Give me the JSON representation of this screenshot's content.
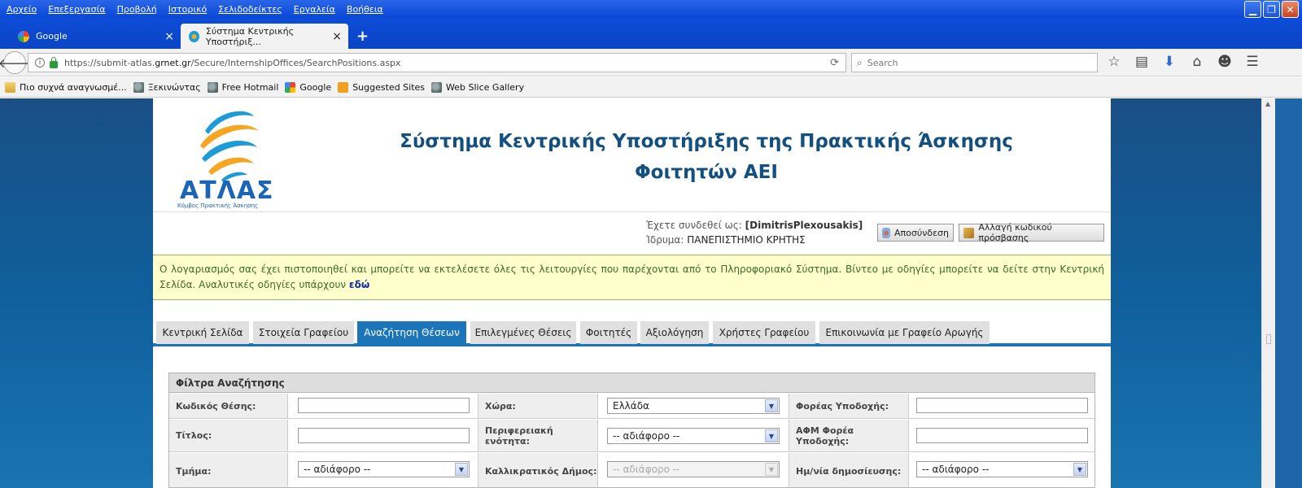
{
  "browser": {
    "menu": [
      "Αρχείο",
      "Επεξεργασία",
      "Προβολή",
      "Ιστορικό",
      "Σελιδοδείκτες",
      "Εργαλεία",
      "Βοήθεια"
    ],
    "tabs": [
      {
        "title": "Google",
        "close": "×"
      },
      {
        "title": "Σύστημα Κεντρικής Υποστήριξ...",
        "close": "×"
      }
    ],
    "new_tab": "+",
    "url_prefix": "https://submit-atlas.",
    "url_domain": "grnet.gr",
    "url_path": "/Secure/InternshipOffices/SearchPositions.aspx",
    "search_placeholder": "Search",
    "bookmarks": [
      "Πιο συχνά αναγνωσμέ...",
      "Ξεκινώντας",
      "Free Hotmail",
      "Google",
      "Suggested Sites",
      "Web Slice Gallery"
    ]
  },
  "header": {
    "logo_word": "ΑΤΛΑΣ",
    "logo_sub": "Κόμβος Πρακτικής Άσκησης",
    "title_line1": "Σύστημα Κεντρικής Υποστήριξης της Πρακτικής Άσκησης",
    "title_line2": "Φοιτητών ΑΕΙ"
  },
  "user": {
    "logged_as_label": "Έχετε συνδεθεί ως:",
    "username": "[DimitrisPlexousakis]",
    "institution_label": "Ίδρυμα:",
    "institution": "ΠΑΝΕΠΙΣΤΗΜΙΟ ΚΡΗΤΗΣ",
    "logout_label": "Αποσύνδεση",
    "change_password_label": "Αλλαγή κωδικού πρόσβασης"
  },
  "notice": {
    "text": "Ο λογαριασμός σας έχει πιστοποιηθεί και μπορείτε να εκτελέσετε όλες τις λειτουργίες που παρέχονται από το Πληροφοριακό Σύστημα. Βίντεο με οδηγίες μπορείτε να δείτε στην Κεντρική Σελίδα. Αναλυτικές οδηγίες υπάρχουν ",
    "link": "εδώ"
  },
  "tabs": [
    "Κεντρική Σελίδα",
    "Στοιχεία Γραφείου",
    "Αναζήτηση Θέσεων",
    "Επιλεγμένες Θέσεις",
    "Φοιτητές",
    "Αξιολόγηση",
    "Χρήστες Γραφείου",
    "Επικοινωνία με Γραφείο Αρωγής"
  ],
  "selected_tab": "Αναζήτηση Θέσεων",
  "filters": {
    "heading": "Φίλτρα Αναζήτησης",
    "position_code_label": "Κωδικός Θέσης:",
    "position_code_value": "",
    "country_label": "Χώρα:",
    "country_value": "Ελλάδα",
    "host_label": "Φορέας Υποδοχής:",
    "host_value": "",
    "title_label": "Τίτλος:",
    "title_value": "",
    "region_label": "Περιφερειακή ενότητα:",
    "region_value": "-- αδιάφορο --",
    "afm_label": "ΑΦΜ Φορέα Υποδοχής:",
    "afm_value": "",
    "department_label": "Τμήμα:",
    "department_value": "-- αδιάφορο --",
    "municipality_label": "Καλλικρατικός Δήμος:",
    "municipality_value": "-- αδιάφορο --",
    "pub_date_label": "Ημ/νία δημοσίευσης:",
    "pub_date_value": "-- αδιάφορο --"
  }
}
